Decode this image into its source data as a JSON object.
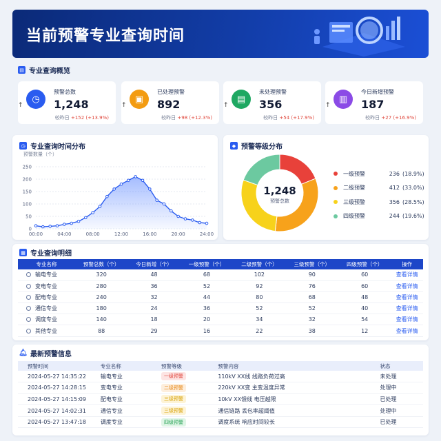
{
  "header": {
    "title": "当前预警专业查询时间"
  },
  "overview": {
    "title": "专业查询概览",
    "cards": [
      {
        "label": "预警总数",
        "value": "1,248",
        "arrow": "↑",
        "cmp_label": "较昨日",
        "delta": "+152",
        "pct": "(+13.9%)",
        "color": "#2a5cf0",
        "icon": "clock-icon",
        "glyph": "◷"
      },
      {
        "label": "已处理预警",
        "value": "892",
        "arrow": "↑",
        "cmp_label": "较昨日",
        "delta": "+98",
        "pct": "(+12.3%)",
        "color": "#f39c12",
        "icon": "processed-icon",
        "glyph": "▣"
      },
      {
        "label": "未处理预警",
        "value": "356",
        "arrow": "↑",
        "cmp_label": "较昨日",
        "delta": "+54",
        "pct": "(+17.9%)",
        "color": "#1fa862",
        "icon": "pending-icon",
        "glyph": "▤"
      },
      {
        "label": "今日新增预警",
        "value": "187",
        "arrow": "↑",
        "cmp_label": "较昨日",
        "delta": "+27",
        "pct": "(+16.9%)",
        "color": "#8b4be6",
        "icon": "new-alert-icon",
        "glyph": "▥"
      }
    ]
  },
  "time_dist": {
    "title": "专业查询时间分布"
  },
  "level_dist": {
    "title": "预警等级分布",
    "center_value": "1,248",
    "center_label": "预警总数",
    "legend": [
      {
        "name": "一级预警",
        "value": "236",
        "pct": "(18.9%)",
        "color": "#e8413a"
      },
      {
        "name": "二级预警",
        "value": "412",
        "pct": "(33.0%)",
        "color": "#f7a21b"
      },
      {
        "name": "三级预警",
        "value": "356",
        "pct": "(28.5%)",
        "color": "#f7d21b"
      },
      {
        "name": "四级预警",
        "value": "244",
        "pct": "(19.6%)",
        "color": "#6cc9a0"
      }
    ]
  },
  "chart_data": [
    {
      "type": "line",
      "title": "",
      "ylabel": "预警数量（个）",
      "xlabel": "",
      "x": [
        0,
        1,
        2,
        3,
        4,
        5,
        6,
        7,
        8,
        9,
        10,
        11,
        12,
        13,
        14,
        15,
        16,
        17,
        18,
        19,
        20,
        21,
        22,
        23,
        24
      ],
      "xticks": [
        "00:00",
        "04:00",
        "08:00",
        "12:00",
        "16:00",
        "20:00",
        "24:00"
      ],
      "yticks": [
        "0",
        "50",
        "100",
        "150",
        "200",
        "250"
      ],
      "ylim": [
        0,
        250
      ],
      "series": [
        {
          "values": [
            12,
            8,
            10,
            12,
            18,
            22,
            30,
            45,
            65,
            90,
            130,
            160,
            180,
            195,
            210,
            195,
            160,
            115,
            100,
            72,
            50,
            40,
            35,
            25,
            22
          ]
        }
      ],
      "grid": true,
      "color": "#2a5cf0"
    },
    {
      "type": "pie",
      "title": "",
      "categories": [
        "一级预警",
        "二级预警",
        "三级预警",
        "四级预警"
      ],
      "values": [
        236,
        412,
        356,
        244
      ],
      "colors": [
        "#e8413a",
        "#f7a21b",
        "#f7d21b",
        "#6cc9a0"
      ]
    }
  ],
  "detail": {
    "title": "专业查询明细",
    "headers": [
      "专业名称",
      "预警总数（个）",
      "今日新增（个）",
      "一级预警（个）",
      "二级预警（个）",
      "三级预警（个）",
      "四级预警（个）",
      "操作"
    ],
    "rows": [
      [
        "输电专业",
        "320",
        "48",
        "68",
        "102",
        "90",
        "60",
        "查看详情"
      ],
      [
        "变电专业",
        "280",
        "36",
        "52",
        "92",
        "76",
        "60",
        "查看详情"
      ],
      [
        "配电专业",
        "240",
        "32",
        "44",
        "80",
        "68",
        "48",
        "查看详情"
      ],
      [
        "通信专业",
        "180",
        "24",
        "36",
        "52",
        "52",
        "40",
        "查看详情"
      ],
      [
        "调度专业",
        "140",
        "18",
        "20",
        "34",
        "32",
        "54",
        "查看详情"
      ],
      [
        "其他专业",
        "88",
        "29",
        "16",
        "22",
        "38",
        "12",
        "查看详情"
      ]
    ]
  },
  "latest": {
    "title": "最新预警信息",
    "headers": [
      "预警时间",
      "专业名称",
      "预警等级",
      "预警内容",
      "状态"
    ],
    "rows": [
      [
        "2024-05-27 14:35:22",
        "输电专业",
        "一级预警",
        "110kV XX线 线路负荷过高",
        "未处理"
      ],
      [
        "2024-05-27 14:28:15",
        "变电专业",
        "二级预警",
        "220kV XX变 主变温度异常",
        "处理中"
      ],
      [
        "2024-05-27 14:15:09",
        "配电专业",
        "三级预警",
        "10kV XX馈线 电压越限",
        "已处理"
      ],
      [
        "2024-05-27 14:02:31",
        "通信专业",
        "三级预警",
        "通信链路 丢包率超阈值",
        "处理中"
      ],
      [
        "2024-05-27 13:47:18",
        "调度专业",
        "四级预警",
        "调度系统 响应时间较长",
        "已处理"
      ]
    ]
  }
}
